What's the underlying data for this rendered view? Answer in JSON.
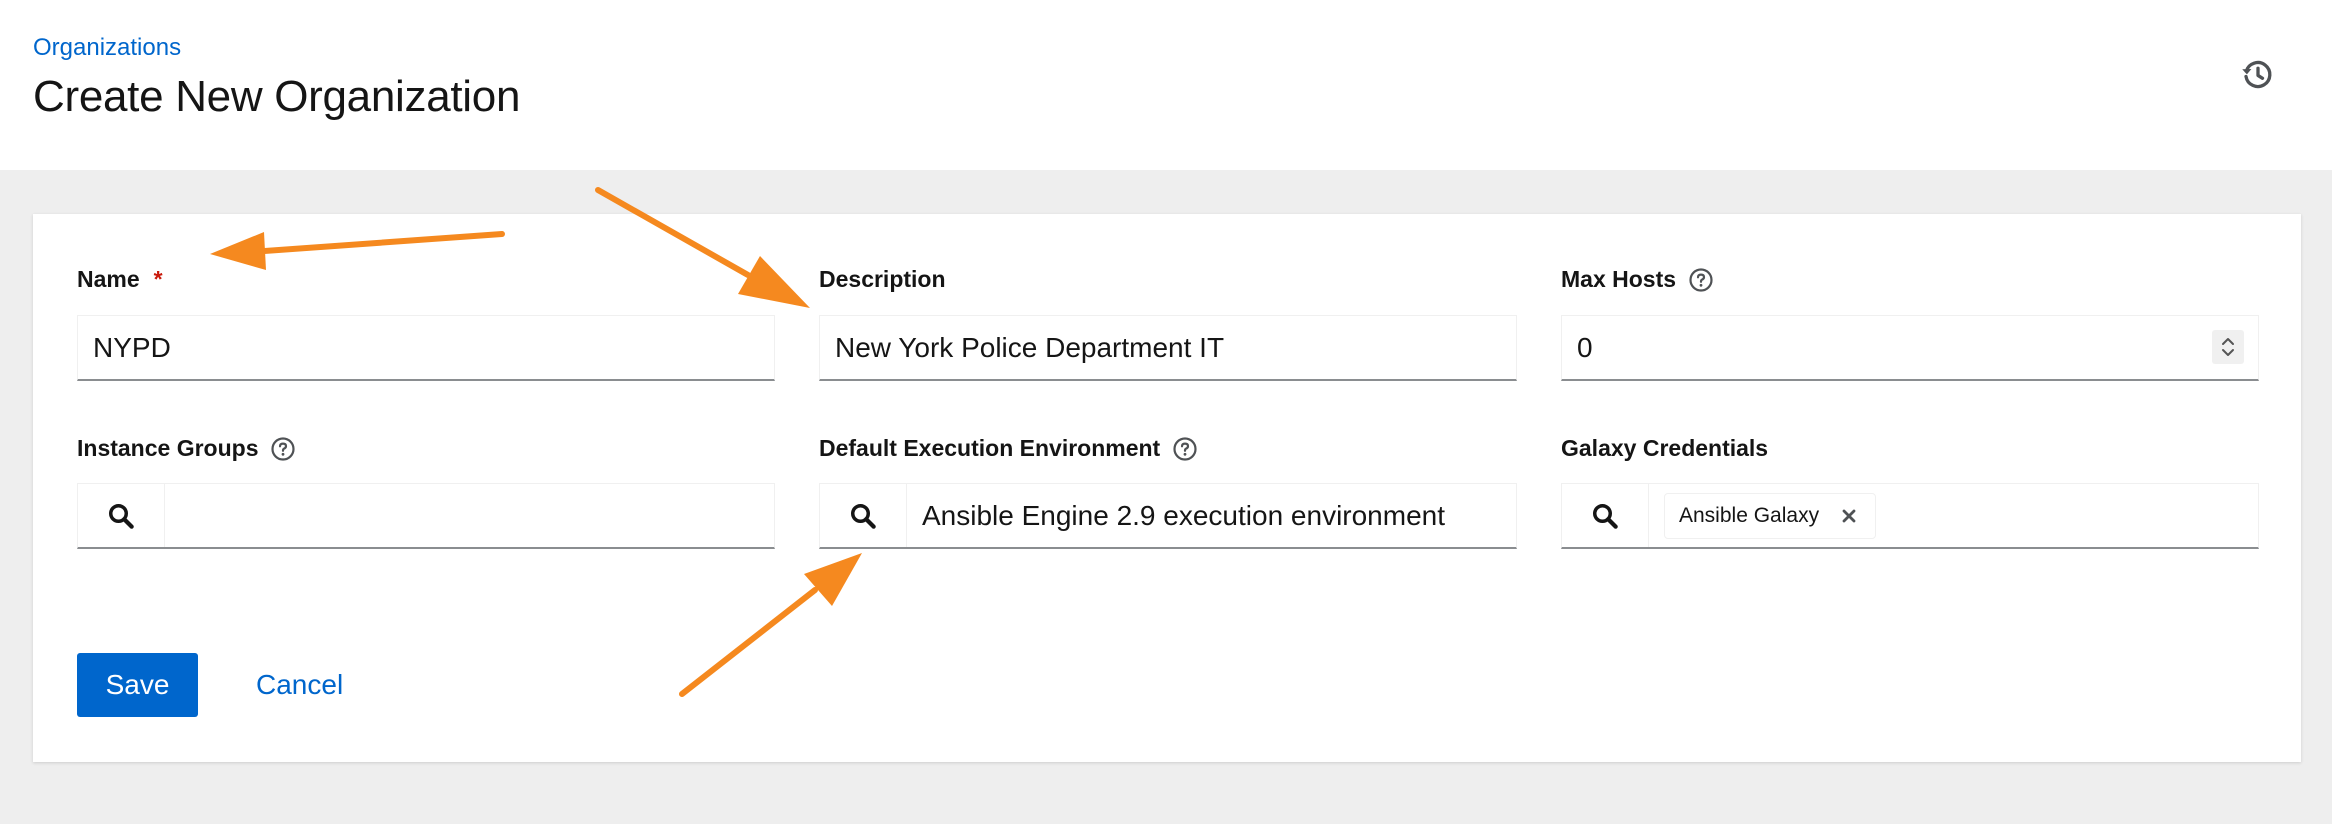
{
  "header": {
    "breadcrumb": "Organizations",
    "title": "Create New Organization",
    "history_icon": "history-icon"
  },
  "form": {
    "name": {
      "label": "Name",
      "required_mark": "*",
      "value": "NYPD"
    },
    "description": {
      "label": "Description",
      "value": "New York Police Department IT"
    },
    "max_hosts": {
      "label": "Max Hosts",
      "value": "0",
      "help_icon": "help-circle-icon"
    },
    "instance_groups": {
      "label": "Instance Groups",
      "value": "",
      "help_icon": "help-circle-icon",
      "search_icon": "search-icon"
    },
    "default_ee": {
      "label": "Default Execution Environment",
      "value": "Ansible Engine 2.9 execution environment",
      "help_icon": "help-circle-icon",
      "search_icon": "search-icon"
    },
    "galaxy_credentials": {
      "label": "Galaxy Credentials",
      "chips": [
        "Ansible Galaxy"
      ],
      "search_icon": "search-icon",
      "remove_icon": "close-icon"
    }
  },
  "actions": {
    "save_label": "Save",
    "cancel_label": "Cancel"
  },
  "colors": {
    "accent": "#0066cc",
    "required": "#c9190b",
    "annotation_arrow": "#f5891f",
    "page_background": "#eeeeee"
  }
}
